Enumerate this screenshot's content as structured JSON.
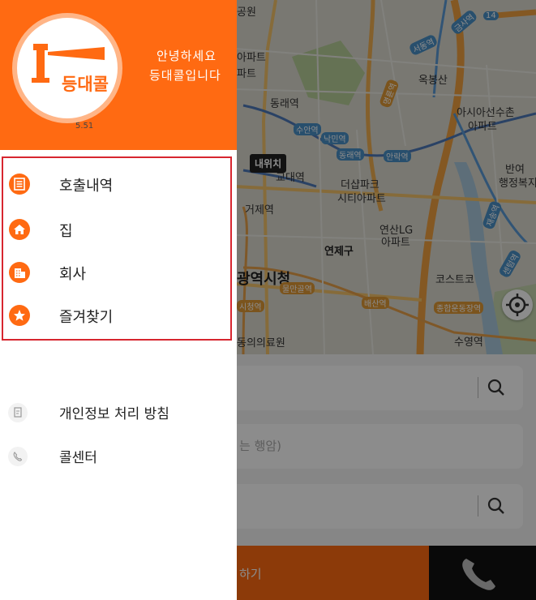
{
  "drawer": {
    "logo_text": "등대콜",
    "version": "5.51",
    "greeting_line1": "안녕하세요",
    "greeting_line2": "등대콜입니다",
    "menu": [
      {
        "label": "호출내역",
        "icon": "list-icon"
      },
      {
        "label": "집",
        "icon": "home-icon"
      },
      {
        "label": "회사",
        "icon": "building-icon"
      },
      {
        "label": "즐겨찾기",
        "icon": "star-icon"
      }
    ],
    "sub_menu": [
      {
        "label": "개인정보 처리 방침",
        "icon": "document-icon"
      },
      {
        "label": "콜센터",
        "icon": "phone-icon"
      }
    ]
  },
  "map": {
    "marker_label": "내위치",
    "road_number": "14",
    "labels": [
      "공원",
      "동래역",
      "수안역",
      "낙민역",
      "명륜역",
      "서동역",
      "금사역",
      "옥봉산",
      "아시아선수촌",
      "아파트",
      "동래역",
      "안락역",
      "반여",
      "행정복지",
      "거제역",
      "교대역",
      "더샵파크",
      "시티아파트",
      "연산LG",
      "아파트",
      "연제구",
      "광역시청",
      "코스트코",
      "배산역",
      "물만골역",
      "시청역",
      "종합운동장역",
      "동의의료원",
      "수영역",
      "센텀역",
      "재송역",
      "파트",
      "아파트"
    ]
  },
  "panel": {
    "field2_text": "는 행암)",
    "call_text": "하기"
  },
  "colors": {
    "brand_orange": "#ff6a12",
    "highlight_red": "#d7262f"
  }
}
